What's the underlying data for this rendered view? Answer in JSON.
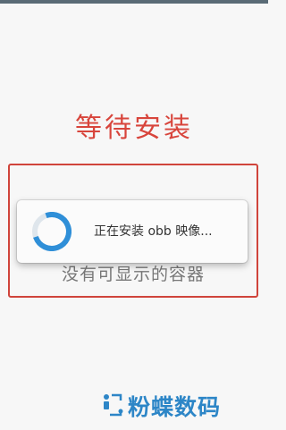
{
  "page": {
    "title": "等待安装",
    "empty_message": "没有可显示的容器"
  },
  "dialog": {
    "message": "正在安装 obb 映像...",
    "spinner_icon": "loading-spinner-icon"
  },
  "watermark": {
    "text": "粉蝶数码",
    "icon": "watermark-logo-icon"
  },
  "colors": {
    "accent_red": "#d0443b",
    "title_red": "#d8453c",
    "spinner_blue": "#2f8fd8",
    "watermark_blue": "#2d86c7"
  }
}
